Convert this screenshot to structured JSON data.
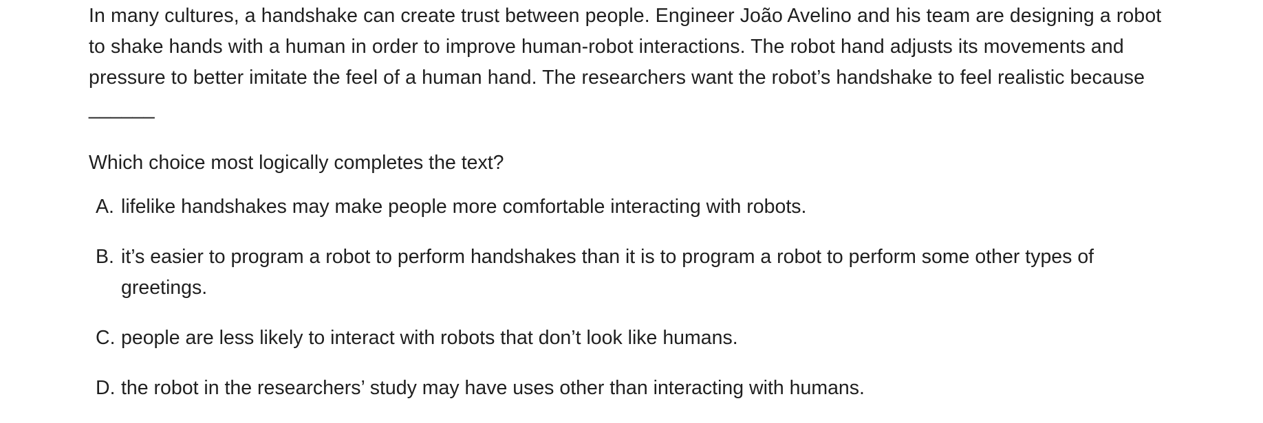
{
  "passage": "In many cultures, a handshake can create trust between people. Engineer João Avelino and his team are designing a robot to shake hands with a human in order to improve human-robot interactions. The robot hand adjusts its movements and pressure to better imitate the feel of a human hand. The researchers want the robot’s handshake to feel realistic because ______",
  "question": "Which choice most logically completes the text?",
  "choices": [
    {
      "letter": "A.",
      "text": "lifelike handshakes may make people more comfortable interacting with robots."
    },
    {
      "letter": "B.",
      "text": "it’s easier to program a robot to perform handshakes than it is to program a robot to perform some other types of greetings."
    },
    {
      "letter": "C.",
      "text": "people are less likely to interact with robots that don’t look like humans."
    },
    {
      "letter": "D.",
      "text": "the robot in the researchers’ study may have uses other than interacting with humans."
    }
  ]
}
